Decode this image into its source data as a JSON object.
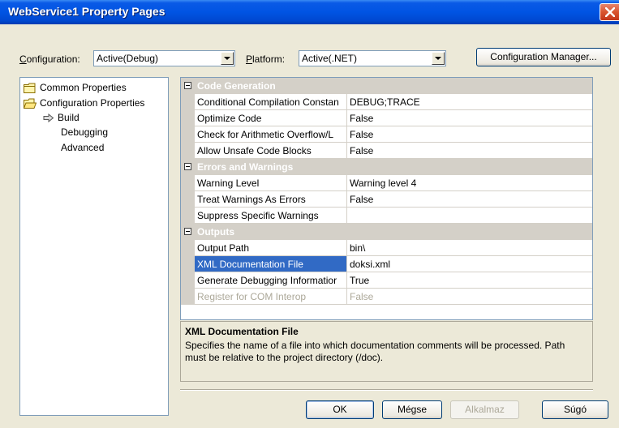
{
  "window": {
    "title": "WebService1 Property Pages"
  },
  "toolbar": {
    "configuration_label": "onfiguration:",
    "configuration_accel": "C",
    "configuration_value": "Active(Debug)",
    "platform_label": "latform:",
    "platform_accel": "P",
    "platform_value": "Active(.NET)",
    "config_manager_label": "Configuration Manager..."
  },
  "tree": {
    "items": [
      {
        "label": "Common Properties"
      },
      {
        "label": "Configuration Properties"
      },
      {
        "label": "Build"
      },
      {
        "label": "Debugging"
      },
      {
        "label": "Advanced"
      }
    ]
  },
  "grid": {
    "categories": [
      {
        "label": "Code Generation",
        "rows": [
          {
            "name": "Conditional Compilation Constan",
            "value": "DEBUG;TRACE"
          },
          {
            "name": "Optimize Code",
            "value": "False"
          },
          {
            "name": "Check for Arithmetic Overflow/L",
            "value": "False"
          },
          {
            "name": "Allow Unsafe Code Blocks",
            "value": "False"
          }
        ]
      },
      {
        "label": "Errors and Warnings",
        "rows": [
          {
            "name": "Warning Level",
            "value": "Warning level 4"
          },
          {
            "name": "Treat Warnings As Errors",
            "value": "False"
          },
          {
            "name": "Suppress Specific Warnings",
            "value": ""
          }
        ]
      },
      {
        "label": "Outputs",
        "rows": [
          {
            "name": "Output Path",
            "value": "bin\\"
          },
          {
            "name": "XML Documentation File",
            "value": "doksi.xml"
          },
          {
            "name": "Generate Debugging Informatior",
            "value": "True"
          },
          {
            "name": "Register for COM Interop",
            "value": "False"
          }
        ]
      }
    ]
  },
  "description": {
    "title": "XML Documentation File",
    "text": "Specifies the name of a file into which documentation comments will be processed. Path must be relative to the project directory (/doc)."
  },
  "buttons": {
    "ok": "OK",
    "cancel": "Mégse",
    "apply": "Alkalmaz",
    "help": "Súgó"
  },
  "colors": {
    "titlebar": "#0054e3",
    "selection": "#316ac5",
    "category": "#d4d0c8"
  }
}
